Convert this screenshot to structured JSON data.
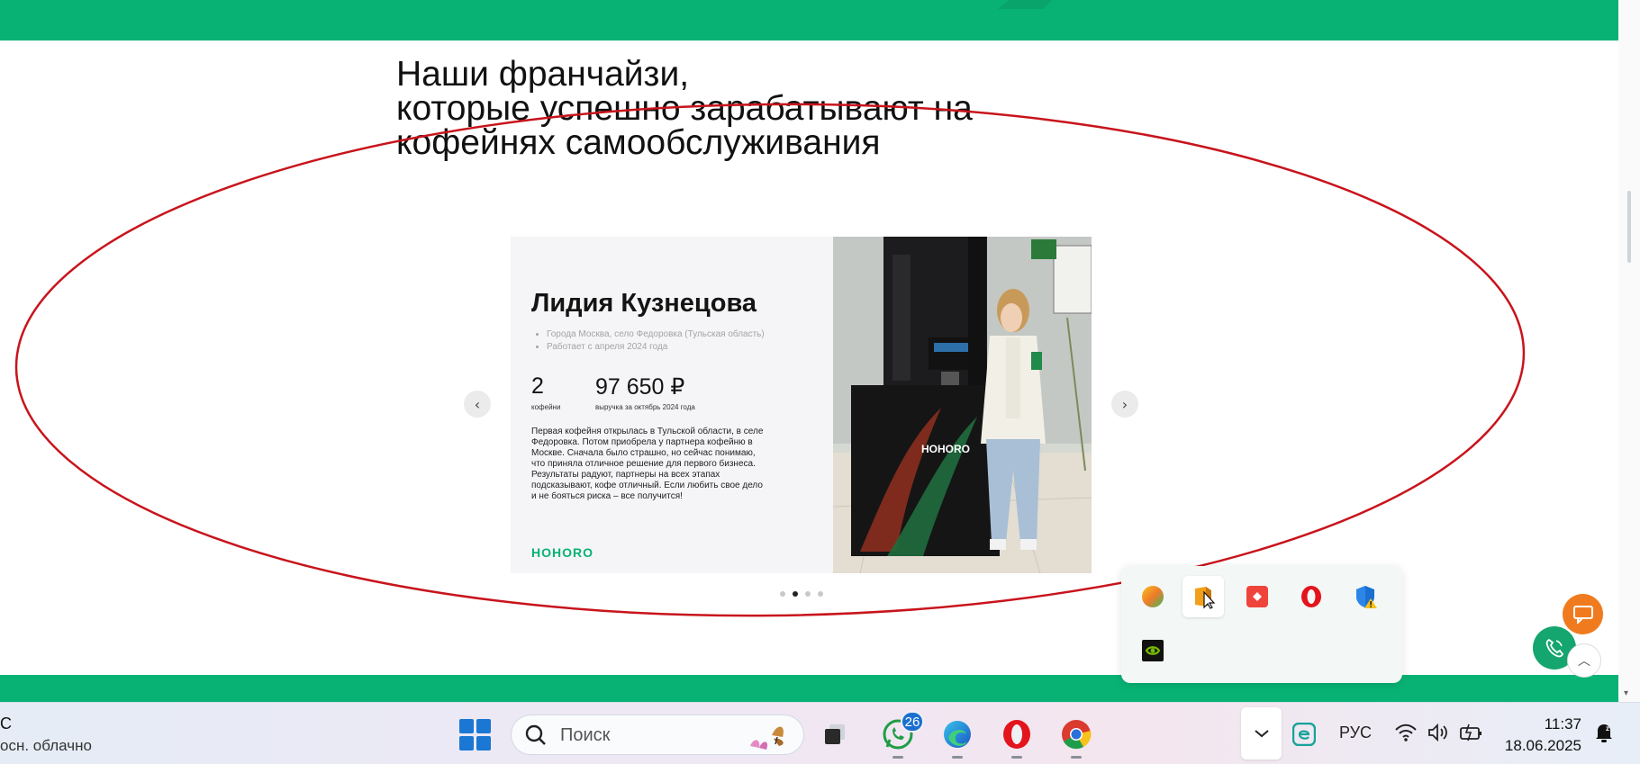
{
  "page": {
    "heading_lines": [
      "Наши франчайзи,",
      "которые успешно зарабатывают на",
      "кофейнях самообслуживания"
    ]
  },
  "card": {
    "name": "Лидия Кузнецова",
    "bullets": [
      "Города Москва, село Федоровка (Тульская область)",
      "Работает с апреля 2024 года"
    ],
    "stats": [
      {
        "value": "2",
        "caption": "кофейни"
      },
      {
        "value": "97 650 ₽",
        "caption": "выручка за октябрь 2024 года"
      }
    ],
    "story": "Первая кофейня открылась в Тульской области, в селе Федоровка. Потом приобрела у партнера кофейню в Москве. Сначала было страшно, но сейчас понимаю, что приняла отличное решение для первого бизнеса. Результаты радуют, партнеры на всех этапах подсказывают, кофе отличный. Если любить свое дело и не бояться риска – все получится!",
    "brand": "HOHORO",
    "machine_brand": "HOHORO"
  },
  "carousel": {
    "prev_icon": "chevron-left-icon",
    "next_icon": "chevron-right-icon",
    "dots": 4,
    "active_dot": 1
  },
  "tray_overflow": {
    "icons": [
      "colorful-circle-app-icon",
      "box-app-icon",
      "anydesk-icon",
      "opera-icon",
      "windows-security-warning-icon",
      "nvidia-icon"
    ]
  },
  "taskbar": {
    "weather_temp": "C",
    "weather_desc": "осн. облачно",
    "search_placeholder": "Поиск",
    "whatsapp_badge": "26",
    "language": "РУС",
    "time": "11:37",
    "date": "18.06.2025"
  },
  "colors": {
    "brand_green": "#08b275",
    "annotation_red": "#c8141c",
    "chat_orange": "#f07b1f"
  }
}
